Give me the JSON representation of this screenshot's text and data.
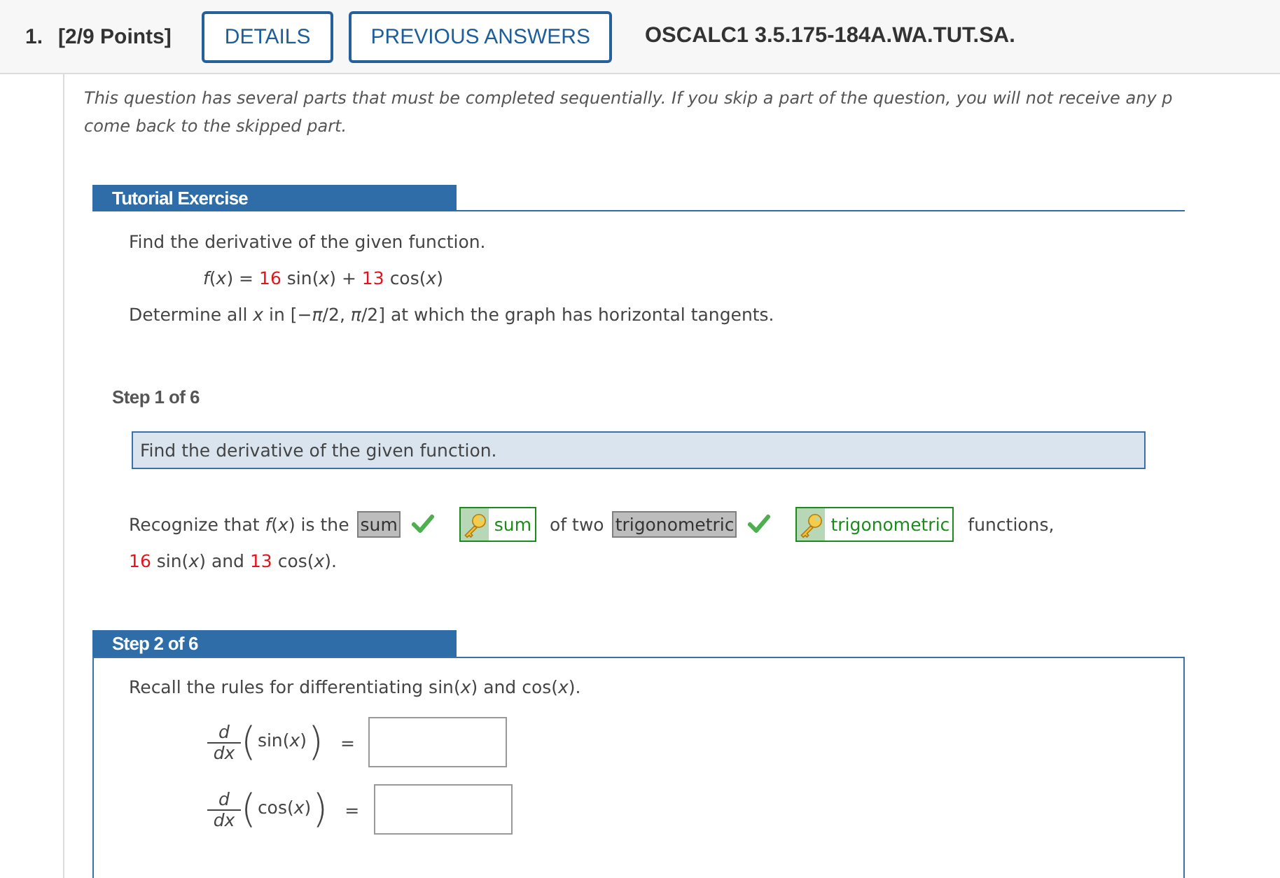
{
  "header": {
    "number": "1.",
    "points": "[2/9 Points]",
    "buttons": [
      "DETAILS",
      "PREVIOUS ANSWERS"
    ],
    "title": "OSCALC1 3.5.175-184A.WA.TUT.SA."
  },
  "intro_lines": [
    "This question has several parts that must be completed sequentially. If you skip a part of the question, you will not receive any p",
    "come back to the skipped part."
  ],
  "tutorial": {
    "title": "Tutorial Exercise",
    "prompt": "Find the derivative of the given function.",
    "formula": [
      {
        "kind": "math",
        "text": "*f*(*x*) ="
      },
      {
        "kind": "coefficient",
        "text": "16"
      },
      {
        "kind": "math",
        "text": "sin(*x*) +"
      },
      {
        "kind": "coefficient",
        "text": "13"
      },
      {
        "kind": "math",
        "text": "cos(*x*)"
      }
    ],
    "task": "Determine all *x* in [−*π*/2, *π*/2] at which the graph has horizontal tangents."
  },
  "steps": [
    {
      "kind": "completed",
      "title": "Step 1 of 6",
      "instruction": "Find the derivative of the given function.",
      "sentence": [
        {
          "kind": "text",
          "text": "Recognize that *f*(*x*) is the"
        },
        {
          "kind": "answer",
          "value": "sum",
          "correct": true,
          "key": "sum"
        },
        {
          "kind": "text",
          "text": "of two"
        },
        {
          "kind": "answer",
          "value": "trigonometric",
          "correct": true,
          "key": "trigonometric"
        },
        {
          "kind": "text",
          "text": "functions,"
        }
      ],
      "sentence_end": [
        {
          "kind": "coefficient",
          "text": "16"
        },
        {
          "kind": "math",
          "text": "sin(*x*) and"
        },
        {
          "kind": "coefficient",
          "text": "13"
        },
        {
          "kind": "math",
          "text": "cos(*x*)."
        }
      ]
    },
    {
      "kind": "current",
      "title": "Step 2 of 6",
      "instruction": "Recall the rules for differentiating sin(*x*) and cos(*x*).",
      "equations": [
        {
          "numerator": "d",
          "denominator": "dx",
          "open": "(",
          "function": "sin(*x*)",
          "close": ")",
          "equals": "="
        },
        {
          "numerator": "d",
          "denominator": "dx",
          "open": "(",
          "function": "cos(*x*)",
          "close": ")",
          "equals": "="
        }
      ]
    }
  ]
}
